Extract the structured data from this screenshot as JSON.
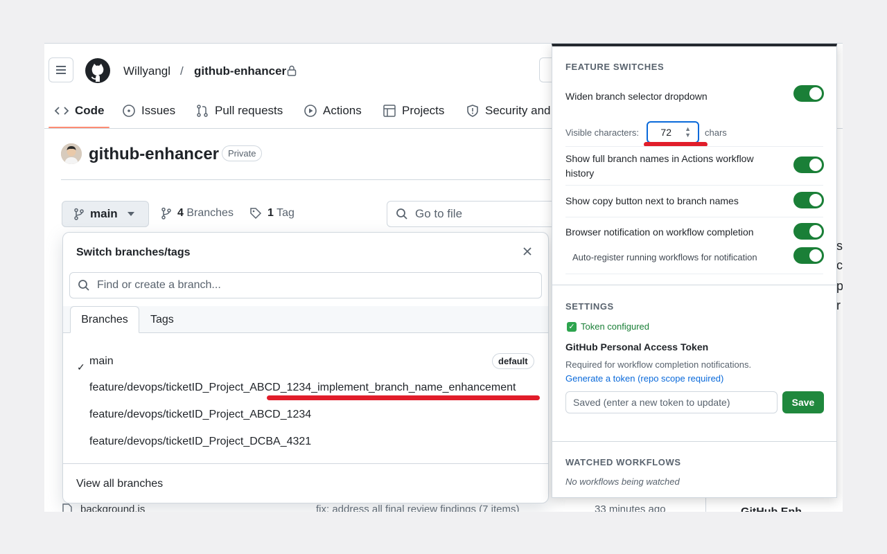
{
  "header": {
    "owner": "Willyangl",
    "separator": "/",
    "repo": "github-enhancer"
  },
  "nav": {
    "tabs": [
      {
        "label": "Code"
      },
      {
        "label": "Issues"
      },
      {
        "label": "Pull requests"
      },
      {
        "label": "Actions"
      },
      {
        "label": "Projects"
      },
      {
        "label": "Security and"
      }
    ]
  },
  "repo": {
    "title": "github-enhancer",
    "visibility": "Private"
  },
  "branch_bar": {
    "current_branch": "main",
    "branch_count": "4",
    "branch_word": "Branches",
    "tag_count": "1",
    "tag_word": "Tag",
    "goto_placeholder": "Go to file"
  },
  "background_file": {
    "name": "background.js",
    "commit": "fix: address all final review findings (7 items)",
    "time": "33 minutes ago"
  },
  "right_fragments": [
    "s",
    "c",
    "p",
    "r",
    "GitHub Enh"
  ],
  "dropdown": {
    "title": "Switch branches/tags",
    "search_placeholder": "Find or create a branch...",
    "tabs": [
      "Branches",
      "Tags"
    ],
    "branches": [
      {
        "name": "main",
        "checked": true,
        "badge": "default"
      },
      {
        "name": "feature/devops/ticketID_Project_ABCD_1234_implement_branch_name_enhancement"
      },
      {
        "name": "feature/devops/ticketID_Project_ABCD_1234"
      },
      {
        "name": "feature/devops/ticketID_Project_DCBA_4321"
      }
    ],
    "view_all": "View all branches"
  },
  "panel": {
    "feature_switches": {
      "heading": "FEATURE SWITCHES",
      "widen_label": "Widen branch selector dropdown",
      "visible_chars_label": "Visible characters:",
      "visible_chars_value": "72",
      "chars_unit": "chars",
      "full_names_label": "Show full branch names in Actions workflow history",
      "copy_button_label": "Show copy button next to branch names",
      "notification_label": "Browser notification on workflow completion",
      "auto_register_label": "Auto-register running workflows for notification"
    },
    "settings": {
      "heading": "SETTINGS",
      "token_status": "Token configured",
      "pat_heading": "GitHub Personal Access Token",
      "pat_description": "Required for workflow completion notifications.",
      "pat_link": "Generate a token (repo scope required)",
      "token_placeholder": "Saved (enter a new token to update)",
      "save_label": "Save"
    },
    "watched": {
      "heading": "WATCHED WORKFLOWS",
      "empty": "No workflows being watched"
    }
  },
  "colors": {
    "toggle_on": "#1a7f37",
    "save_button": "#1f883d",
    "link": "#0969da",
    "annotation": "#e11d2a",
    "nav_active_underline": "#fd8c73"
  }
}
